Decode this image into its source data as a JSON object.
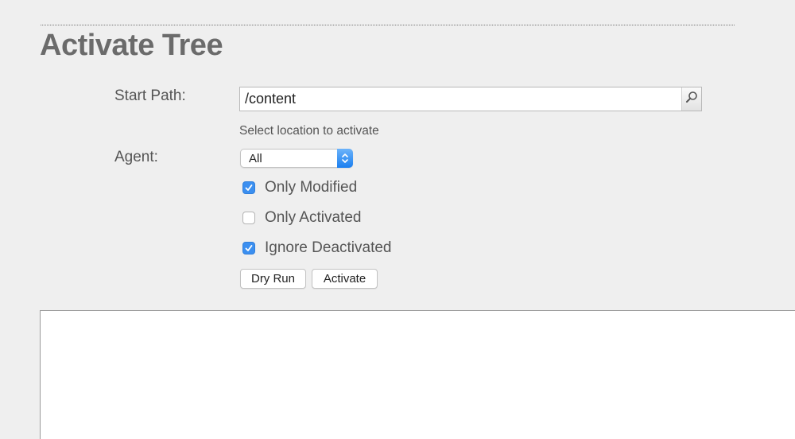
{
  "header": {
    "title": "Activate Tree"
  },
  "form": {
    "start_path": {
      "label": "Start Path:",
      "value": "/content",
      "helper": "Select location to activate",
      "icon": "search-icon"
    },
    "agent": {
      "label": "Agent:",
      "selected": "All"
    },
    "options": [
      {
        "label": "Only Modified",
        "checked": true
      },
      {
        "label": "Only Activated",
        "checked": false
      },
      {
        "label": "Ignore Deactivated",
        "checked": true
      }
    ],
    "buttons": {
      "dry_run": "Dry Run",
      "activate": "Activate"
    }
  },
  "colors": {
    "background": "#efefef",
    "accent": "#3b8ff0",
    "title": "#6b6b6b"
  }
}
